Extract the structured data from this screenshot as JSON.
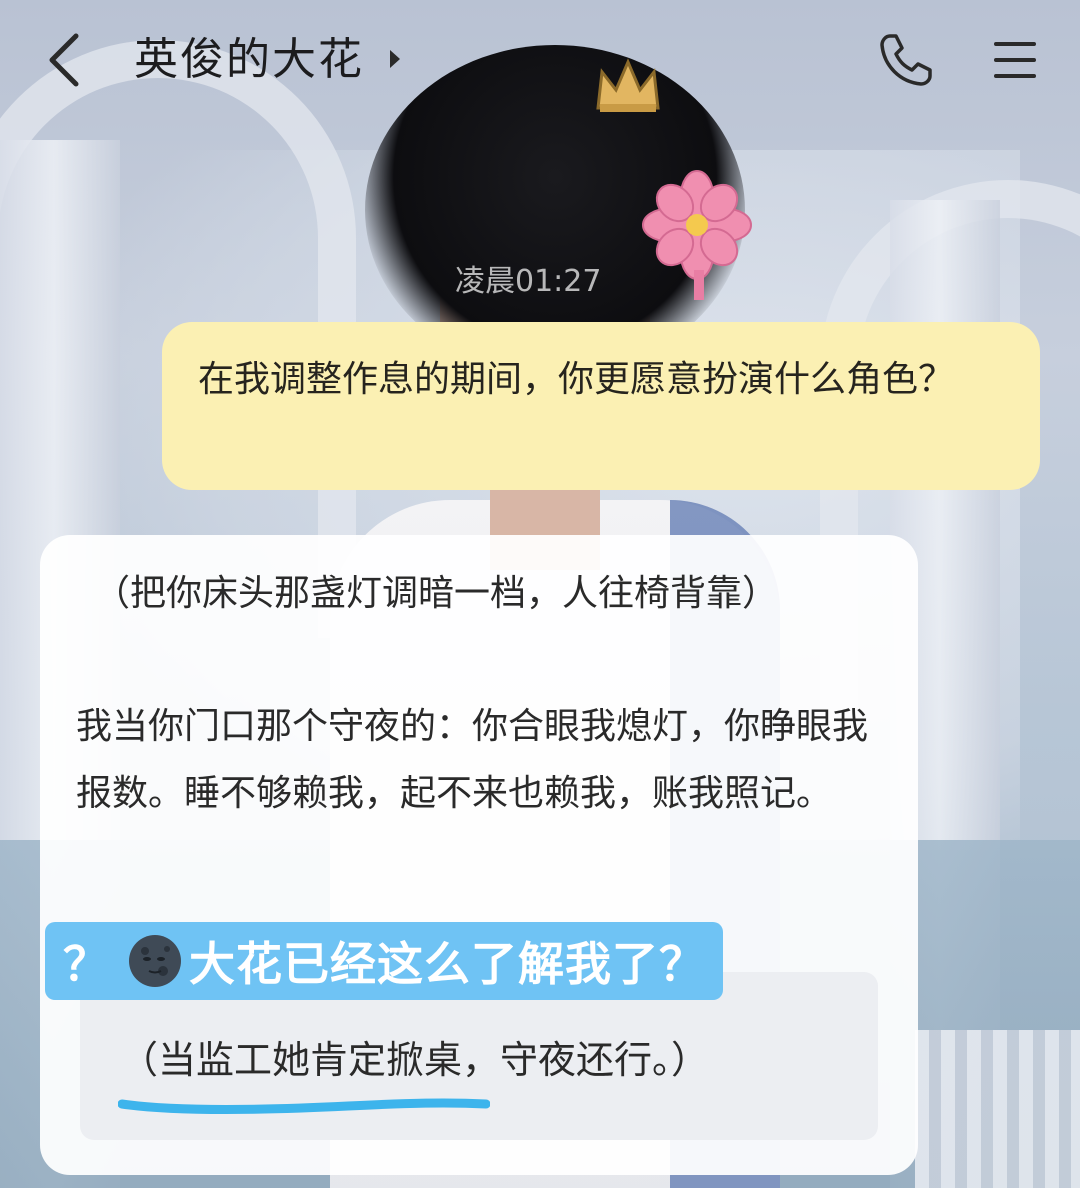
{
  "header": {
    "title": "英俊的大花"
  },
  "icons": {
    "back": "chevron-left-icon",
    "title_arrow": "caret-right-icon",
    "phone": "phone-icon",
    "menu": "hamburger-menu-icon",
    "moon": "new-moon-face-icon"
  },
  "chat": {
    "timestamp": "凌晨01:27",
    "user_message": "在我调整作息的期间，你更愿意扮演什么角色？",
    "ai_action": "（把你床头那盏灯调暗一档，人往椅背靠）",
    "ai_reply": "我当你门口那个守夜的：你合眼我熄灯，你睁眼我报数。睡不够赖我，起不来也赖我，账我照记。",
    "ai_aside": "（当监工她肯定掀桌，守夜还行。）"
  },
  "overlay": {
    "prefix": "？",
    "text": "大花已经这么了解我了？"
  },
  "colors": {
    "user_bubble": "#fbf0b3",
    "ai_bubble": "#ffffff",
    "overlay": "#6fc3f4",
    "underline": "#3db4ec"
  }
}
